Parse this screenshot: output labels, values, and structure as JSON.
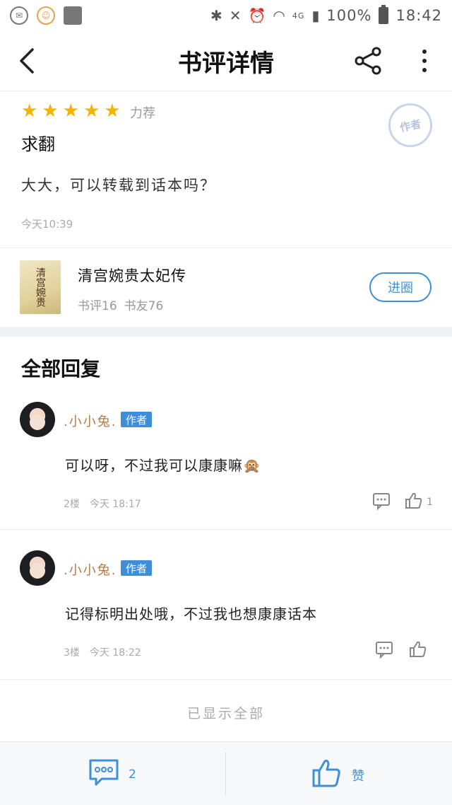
{
  "status_bar": {
    "battery": "100%",
    "time": "18:42",
    "network": "4G"
  },
  "header": {
    "title": "书评详情"
  },
  "review": {
    "rating_stars": 5,
    "rating_label": "力荐",
    "stamp_text": "作者",
    "title": "求翻",
    "body": "大大，可以转载到话本吗？",
    "time": "今天10:39"
  },
  "book": {
    "cover_text": "清宫婉贵",
    "name": "清宫婉贵太妃传",
    "reviews": "书评16",
    "friends": "书友76",
    "enter_label": "进圈"
  },
  "replies": {
    "header": "全部回复",
    "items": [
      {
        "username": ".小小兔.",
        "badge": "作者",
        "text": "可以呀，不过我可以康康嘛🙊",
        "floor": "2楼",
        "time": "今天 18:17",
        "likes": "1"
      },
      {
        "username": ".小小兔.",
        "badge": "作者",
        "text": "记得标明出处哦，不过我也想康康话本",
        "floor": "3楼",
        "time": "今天 18:22",
        "likes": ""
      }
    ],
    "footer": "已显示全部"
  },
  "bottom_bar": {
    "comment_count": "2",
    "like_label": "赞"
  },
  "colors": {
    "accent": "#3d8fd6",
    "star": "#f5b400",
    "username": "#b47a45"
  }
}
